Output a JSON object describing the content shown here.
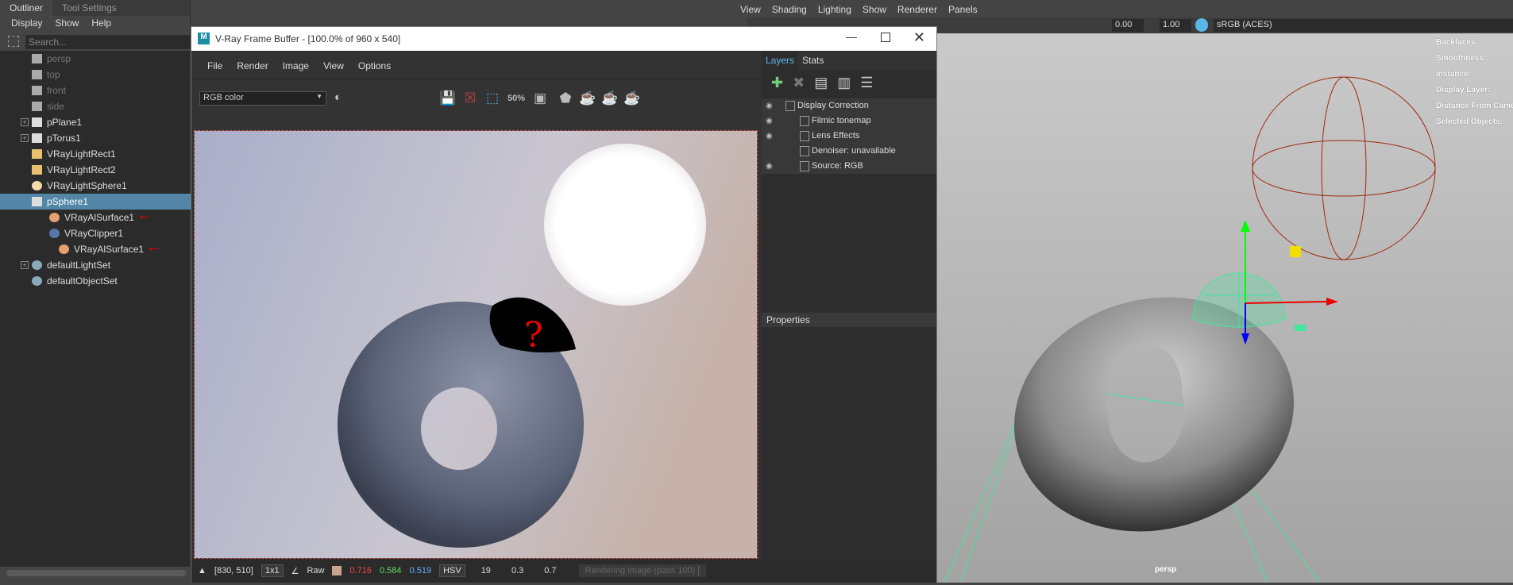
{
  "outliner": {
    "tabs": [
      "Outliner",
      "Tool Settings"
    ],
    "menu": [
      "Display",
      "Show",
      "Help"
    ],
    "search_placeholder": "Search...",
    "items": [
      {
        "label": "persp",
        "icon": "camera-icon",
        "dim": true
      },
      {
        "label": "top",
        "icon": "camera-icon",
        "dim": true
      },
      {
        "label": "front",
        "icon": "camera-icon",
        "dim": true
      },
      {
        "label": "side",
        "icon": "camera-icon",
        "dim": true
      },
      {
        "label": "pPlane1",
        "icon": "transform-icon",
        "expand": true
      },
      {
        "label": "pTorus1",
        "icon": "transform-icon",
        "expand": true
      },
      {
        "label": "VRayLightRect1",
        "icon": "rect-light-icon"
      },
      {
        "label": "VRayLightRect2",
        "icon": "rect-light-icon"
      },
      {
        "label": "VRayLightSphere1",
        "icon": "sphere-light-icon"
      },
      {
        "label": "pSphere1",
        "icon": "transform-icon",
        "selected": true
      },
      {
        "label": "VRayAlSurface1",
        "icon": "material-sphere-icon",
        "indent": 1,
        "annotated": true
      },
      {
        "label": "VRayClipper1",
        "icon": "clipper-icon",
        "indent": 1
      },
      {
        "label": "VRayAlSurface1",
        "icon": "material-sphere-icon",
        "indent": 2,
        "annotated": true
      },
      {
        "label": "defaultLightSet",
        "icon": "set-icon",
        "expand": true
      },
      {
        "label": "defaultObjectSet",
        "icon": "set-icon"
      }
    ]
  },
  "vfb": {
    "title": "V-Ray Frame Buffer - [100.0% of 960 x 540]",
    "menu": [
      "File",
      "Render",
      "Image",
      "View",
      "Options"
    ],
    "channel": "RGB color",
    "zoom_badge": "50%",
    "tabs": [
      "Layers",
      "Stats"
    ],
    "layers": [
      {
        "label": "Display Correction",
        "eye": true
      },
      {
        "label": "Filmic tonemap",
        "eye": true
      },
      {
        "label": "Lens Effects",
        "eye": true
      },
      {
        "label": "Denoiser: unavailable",
        "eye": false
      },
      {
        "label": "Source: RGB",
        "eye": true
      }
    ],
    "properties": "Properties",
    "status": {
      "coords": "[830, 510]",
      "sampling": "1x1",
      "mode": "Raw",
      "swatch": "#c9a48f",
      "r": "0.716",
      "g": "0.584",
      "b": "0.519",
      "space": "HSV",
      "h": "19",
      "s": "0.3",
      "v": "0.7",
      "progress": "Rendering image (pass 100) ["
    },
    "annotation": "?"
  },
  "maya": {
    "menu": [
      "View",
      "Shading",
      "Lighting",
      "Show",
      "Renderer",
      "Panels"
    ],
    "exposure": "0.00",
    "gamma": "1.00",
    "colorspace": "sRGB (ACES)",
    "hud": [
      "Backfaces:",
      "Smoothness:",
      "Instance:",
      "Display Layer:",
      "Distance From Camera:",
      "Selected Objects:"
    ],
    "camera": "persp"
  },
  "colors": {
    "selection": "#5285a6",
    "accent": "#5bb8e6",
    "wire_green": "#3fe8a0",
    "wire_red": "#a02810",
    "annotation": "#e00000"
  }
}
